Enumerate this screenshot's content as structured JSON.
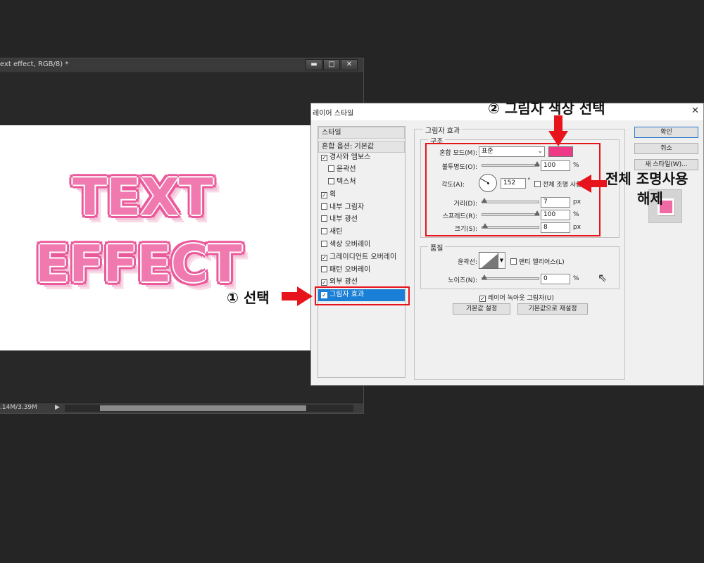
{
  "document": {
    "title": "ext effect, RGB/8) *",
    "window_buttons": {
      "minimize": "▬",
      "maximize": "□",
      "close": "✕"
    },
    "canvas_text": {
      "line1": "TEXT",
      "line2": "EFFECT"
    },
    "status": {
      "doc_size": ".14M/3.39M",
      "arrow": "▶"
    }
  },
  "dialog": {
    "title": "레이어 스타일",
    "close": "✕",
    "style_list": [
      {
        "label": "스타일",
        "checkbox": false,
        "checked": false,
        "indent": false,
        "selected": false
      },
      {
        "label": "혼합 옵션: 기본값",
        "checkbox": false,
        "checked": false,
        "indent": false,
        "selected": false
      },
      {
        "label": "경사와 엠보스",
        "checkbox": true,
        "checked": true,
        "indent": false,
        "selected": false
      },
      {
        "label": "윤곽선",
        "checkbox": true,
        "checked": false,
        "indent": true,
        "selected": false
      },
      {
        "label": "텍스처",
        "checkbox": true,
        "checked": false,
        "indent": true,
        "selected": false
      },
      {
        "label": "획",
        "checkbox": true,
        "checked": true,
        "indent": false,
        "selected": false
      },
      {
        "label": "내부 그림자",
        "checkbox": true,
        "checked": false,
        "indent": false,
        "selected": false
      },
      {
        "label": "내부 광선",
        "checkbox": true,
        "checked": false,
        "indent": false,
        "selected": false
      },
      {
        "label": "새틴",
        "checkbox": true,
        "checked": false,
        "indent": false,
        "selected": false
      },
      {
        "label": "색상 오버레이",
        "checkbox": true,
        "checked": false,
        "indent": false,
        "selected": false
      },
      {
        "label": "그레이디언트 오버레이",
        "checkbox": true,
        "checked": true,
        "indent": false,
        "selected": false
      },
      {
        "label": "패턴 오버레이",
        "checkbox": true,
        "checked": false,
        "indent": false,
        "selected": false
      },
      {
        "label": "외부 광선",
        "checkbox": true,
        "checked": true,
        "indent": false,
        "selected": false
      },
      {
        "label": "그림자 효과",
        "checkbox": true,
        "checked": true,
        "indent": false,
        "selected": true
      }
    ],
    "drop_shadow": {
      "section_title": "그림자 효과",
      "structure": {
        "title": "구조",
        "blend_mode_label": "혼합 모드(M):",
        "blend_mode_value": "표준",
        "shadow_color": "#ee3a86",
        "opacity_label": "불투명도(O):",
        "opacity_value": "100",
        "opacity_unit": "%",
        "angle_label": "각도(A):",
        "angle_value": "152",
        "angle_unit": "°",
        "global_light_label": "전체 조명 사용",
        "global_light_checked": false,
        "distance_label": "거리(D):",
        "distance_value": "7",
        "distance_unit": "px",
        "spread_label": "스프레드(R):",
        "spread_value": "100",
        "spread_unit": "%",
        "size_label": "크기(S):",
        "size_value": "8",
        "size_unit": "px"
      },
      "quality": {
        "title": "품질",
        "contour_label": "윤곽선:",
        "anti_alias_label": "앤티 앨리어스(L)",
        "noise_label": "노이즈(N):",
        "noise_value": "0",
        "noise_unit": "%"
      },
      "knockout_label": "레이어 녹아웃 그림자(U)",
      "knockout_checked": true,
      "make_default_button": "기본값 설정",
      "reset_default_button": "기본값으로 재설정"
    },
    "buttons": {
      "ok": "확인",
      "cancel": "취소",
      "new_style": "새 스타일(W)..."
    }
  },
  "annotations": {
    "step1": "① 선택",
    "step2": "② 그림자 색상 선택",
    "note_line1": "전체 조명사용",
    "note_line2": "해제",
    "highlight_color": "#e8141c"
  }
}
